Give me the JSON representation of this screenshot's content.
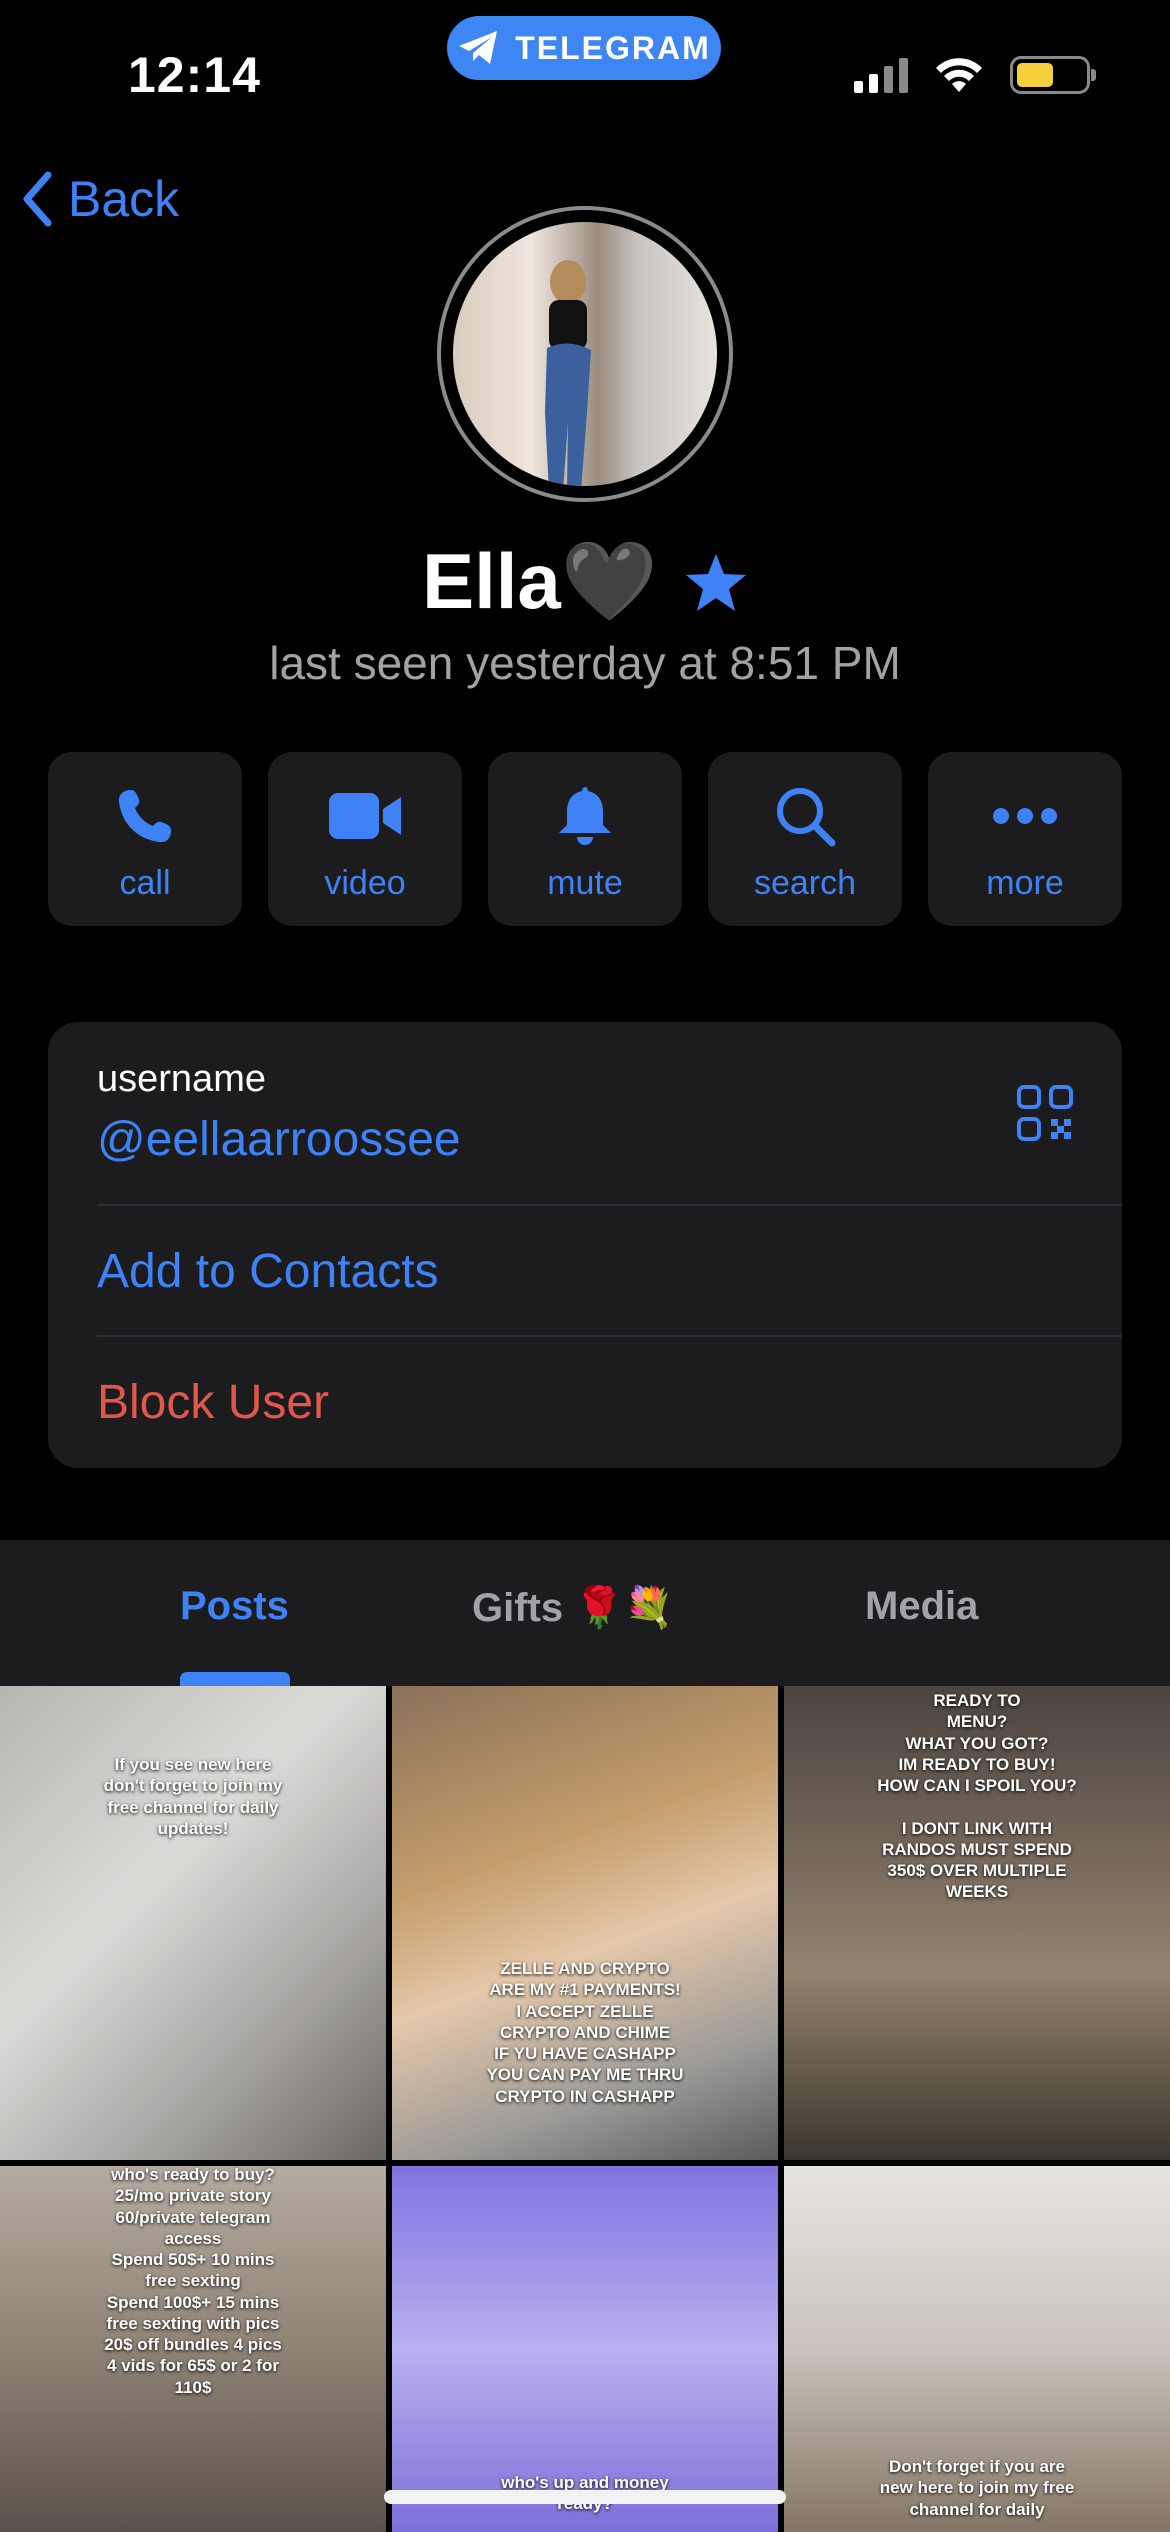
{
  "status_bar": {
    "time": "12:14",
    "app_pill": "TELEGRAM"
  },
  "nav": {
    "back_label": "Back"
  },
  "profile": {
    "name": "Ella🖤",
    "last_seen": "last seen yesterday at 8:51 PM"
  },
  "actions": [
    {
      "label": "call",
      "icon": "phone-icon"
    },
    {
      "label": "video",
      "icon": "video-camera-icon"
    },
    {
      "label": "mute",
      "icon": "bell-icon"
    },
    {
      "label": "search",
      "icon": "search-icon"
    },
    {
      "label": "more",
      "icon": "more-dots-icon"
    }
  ],
  "info": {
    "username_label": "username",
    "username_value": "@eellaarroossee",
    "add_contacts": "Add to Contacts",
    "block_user": "Block User"
  },
  "tabs": {
    "posts": "Posts",
    "gifts": "Gifts 🌹💐",
    "media": "Media"
  },
  "posts": [
    {
      "caption": "If you see new here\ndon't forget to join my\nfree channel for daily\nupdates!"
    },
    {
      "caption": "ZELLE AND CRYPTO\nARE MY #1 PAYMENTS!\nI ACCEPT ZELLE\nCRYPTO AND CHIME\nIF YU HAVE CASHAPP\nYOU CAN PAY ME THRU\nCRYPTO IN CASHAPP"
    },
    {
      "caption": "READY TO\nMENU?\nWHAT YOU GOT?\nIM READY TO BUY!\nHOW CAN I SPOIL YOU?\n\nI DONT LINK WITH\nRANDOS MUST SPEND\n350$ OVER MULTIPLE\nWEEKS"
    },
    {
      "caption": "who's ready to buy?\n25/mo private story\n60/private telegram\naccess\nSpend 50$+ 10 mins\nfree sexting\nSpend 100$+ 15 mins\nfree sexting with pics\n20$ off bundles 4 pics\n4 vids for 65$ or 2 for\n110$"
    },
    {
      "caption": "who's up and money\nready?"
    },
    {
      "caption": "Don't forget if you are\nnew here to join my free\nchannel for daily"
    }
  ],
  "colors": {
    "accent": "#3e82f6",
    "destructive": "#e0574b",
    "card_bg": "#1c1c1e",
    "secondary_text": "#a2a2a7"
  }
}
